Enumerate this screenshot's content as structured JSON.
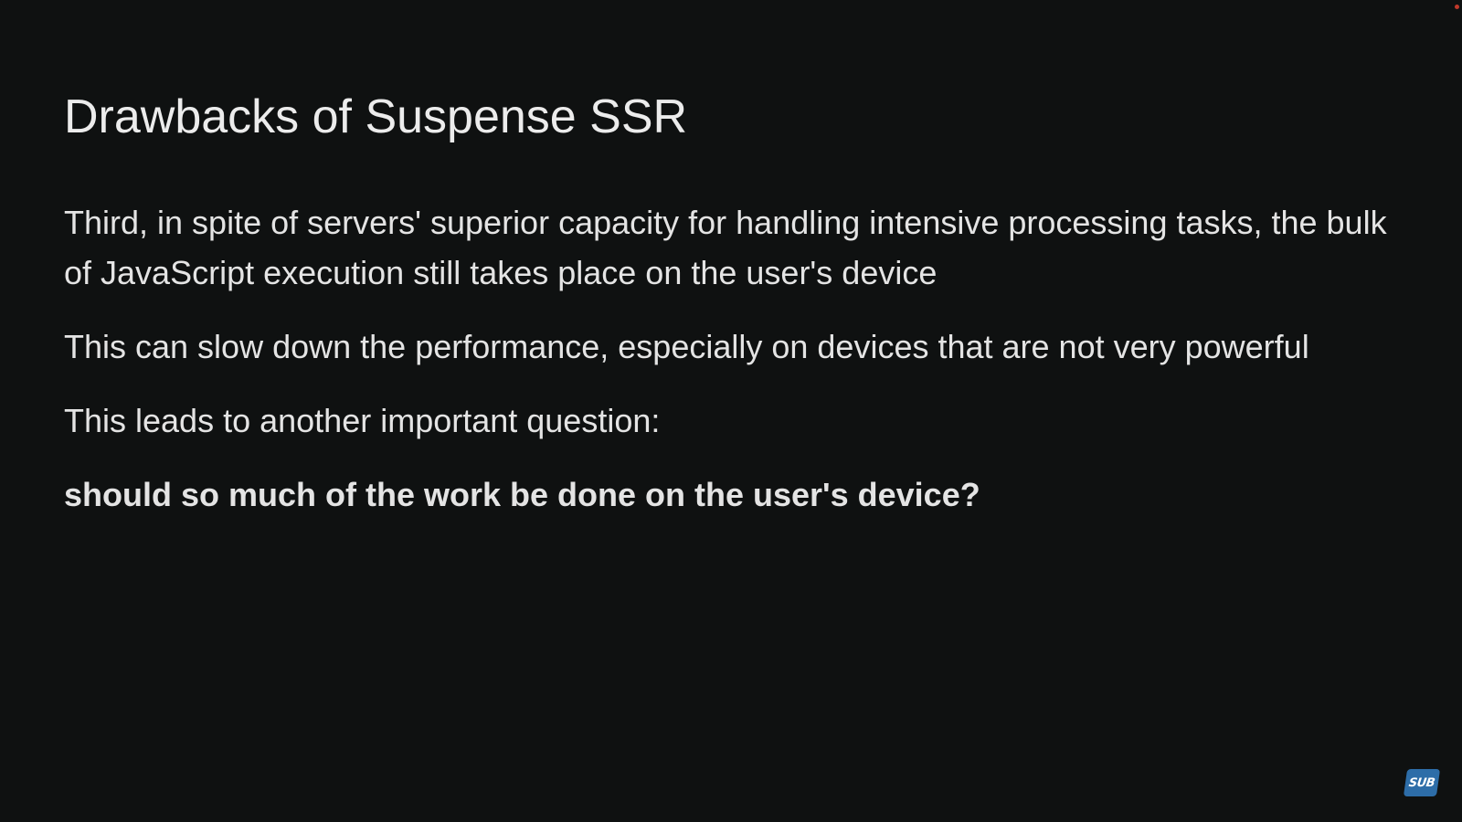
{
  "slide": {
    "title": "Drawbacks of Suspense SSR",
    "paragraphs": [
      "Third, in spite of servers' superior capacity for handling intensive processing tasks, the bulk of JavaScript execution still takes place on the user's device",
      "This can slow down the performance, especially on devices that are not very powerful",
      "This leads to another important question:"
    ],
    "emphasis": "should so much of the work be done on the user's device?"
  },
  "badge": {
    "label": "SUB",
    "icon": "subscribe-badge-icon",
    "color": "#2d6da8"
  },
  "colors": {
    "background": "#0f1111",
    "text": "#e4e4e4"
  }
}
